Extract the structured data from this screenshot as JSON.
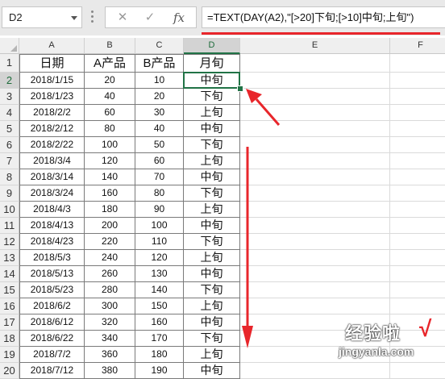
{
  "formula_bar": {
    "name_box": "D2",
    "cancel_icon": "✕",
    "enter_icon": "✓",
    "fx_label": "fx",
    "formula": "=TEXT(DAY(A2),\"[>20]下旬;[>10]中旬;上旬\")"
  },
  "columns": [
    "A",
    "B",
    "C",
    "D",
    "E",
    "F"
  ],
  "selected_cell": "D2",
  "headers": [
    "日期",
    "A产品",
    "B产品",
    "月旬"
  ],
  "rows": [
    {
      "n": "1"
    },
    {
      "n": "2",
      "cells": [
        "2018/1/15",
        "20",
        "10",
        "中旬"
      ]
    },
    {
      "n": "3",
      "cells": [
        "2018/1/23",
        "40",
        "20",
        "下旬"
      ]
    },
    {
      "n": "4",
      "cells": [
        "2018/2/2",
        "60",
        "30",
        "上旬"
      ]
    },
    {
      "n": "5",
      "cells": [
        "2018/2/12",
        "80",
        "40",
        "中旬"
      ]
    },
    {
      "n": "6",
      "cells": [
        "2018/2/22",
        "100",
        "50",
        "下旬"
      ]
    },
    {
      "n": "7",
      "cells": [
        "2018/3/4",
        "120",
        "60",
        "上旬"
      ]
    },
    {
      "n": "8",
      "cells": [
        "2018/3/14",
        "140",
        "70",
        "中旬"
      ]
    },
    {
      "n": "9",
      "cells": [
        "2018/3/24",
        "160",
        "80",
        "下旬"
      ]
    },
    {
      "n": "10",
      "cells": [
        "2018/4/3",
        "180",
        "90",
        "上旬"
      ]
    },
    {
      "n": "11",
      "cells": [
        "2018/4/13",
        "200",
        "100",
        "中旬"
      ]
    },
    {
      "n": "12",
      "cells": [
        "2018/4/23",
        "220",
        "110",
        "下旬"
      ]
    },
    {
      "n": "13",
      "cells": [
        "2018/5/3",
        "240",
        "120",
        "上旬"
      ]
    },
    {
      "n": "14",
      "cells": [
        "2018/5/13",
        "260",
        "130",
        "中旬"
      ]
    },
    {
      "n": "15",
      "cells": [
        "2018/5/23",
        "280",
        "140",
        "下旬"
      ]
    },
    {
      "n": "16",
      "cells": [
        "2018/6/2",
        "300",
        "150",
        "上旬"
      ]
    },
    {
      "n": "17",
      "cells": [
        "2018/6/12",
        "320",
        "160",
        "中旬"
      ]
    },
    {
      "n": "18",
      "cells": [
        "2018/6/22",
        "340",
        "170",
        "下旬"
      ]
    },
    {
      "n": "19",
      "cells": [
        "2018/7/2",
        "360",
        "180",
        "上旬"
      ]
    },
    {
      "n": "20",
      "cells": [
        "2018/7/12",
        "380",
        "190",
        "中旬"
      ]
    }
  ],
  "watermark": {
    "text": "经验啦",
    "check": "√",
    "url": "jingyanla.com"
  },
  "colors": {
    "annotation_red": "#e8262b",
    "selection_green": "#217346"
  }
}
